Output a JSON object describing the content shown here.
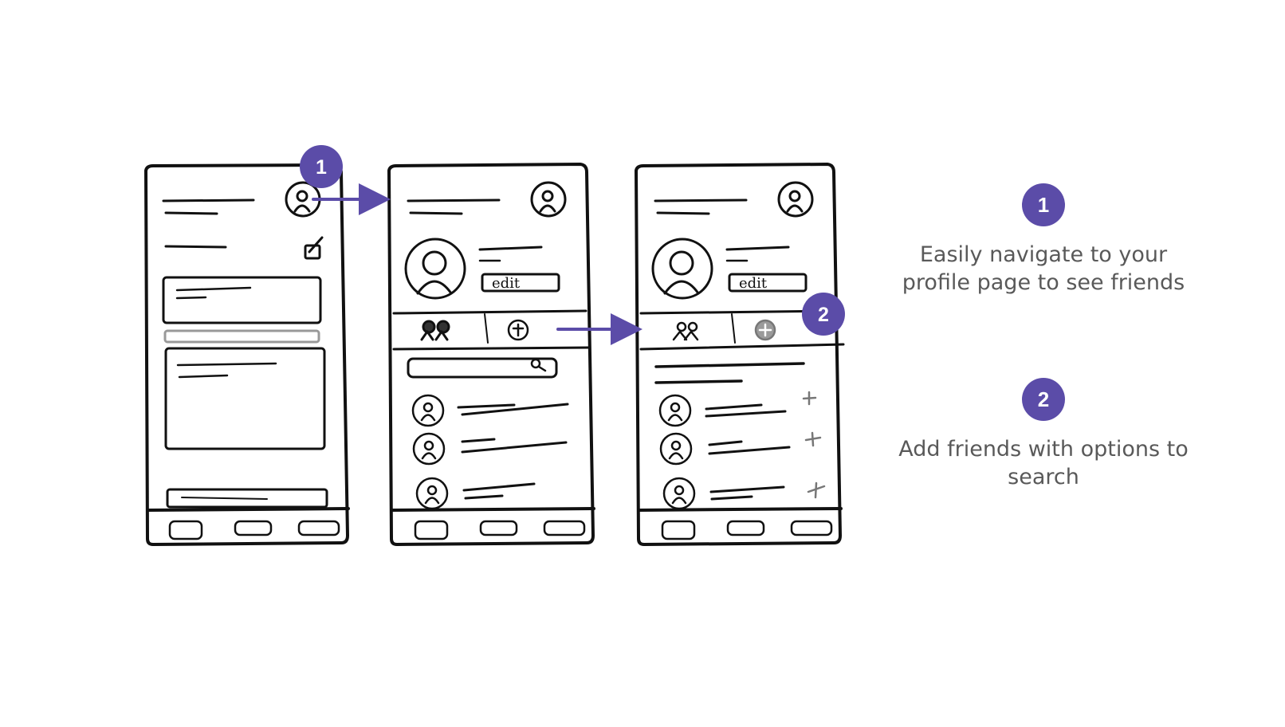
{
  "colors": {
    "accent": "#5b4ca8",
    "ink": "#111111",
    "text": "#595959",
    "gray": "#8c8c8c"
  },
  "sketch_badges": [
    "1",
    "2"
  ],
  "sketch_labels": {
    "edit_1": "edit",
    "edit_2": "edit"
  },
  "legend": [
    {
      "number": "1",
      "text": "Easily navigate to your profile page to see friends"
    },
    {
      "number": "2",
      "text": "Add friends with options to search"
    }
  ],
  "icons": [
    "avatar-icon",
    "edit-icon",
    "friends-icon",
    "add-friend-icon",
    "search-icon",
    "plus-icon",
    "arrow-icon"
  ]
}
